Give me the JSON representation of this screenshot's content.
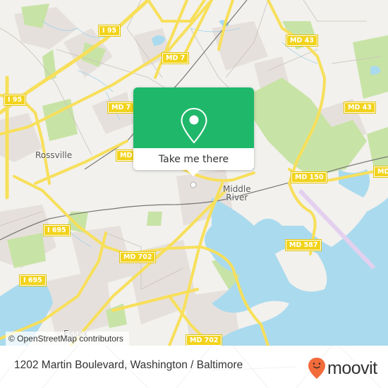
{
  "map": {
    "attribution": "© OpenStreetMap contributors",
    "road_shields": [
      {
        "id": "i95-top",
        "label": "I 95"
      },
      {
        "id": "i95-left",
        "label": "I 95"
      },
      {
        "id": "md7-top",
        "label": "MD 7"
      },
      {
        "id": "md7-mid",
        "label": "MD 7"
      },
      {
        "id": "md7-partial",
        "label": "MD"
      },
      {
        "id": "md43-top",
        "label": "MD 43"
      },
      {
        "id": "md43-right",
        "label": "MD 43"
      },
      {
        "id": "md150",
        "label": "MD 150"
      },
      {
        "id": "md-right-edge",
        "label": "MD"
      },
      {
        "id": "i695-top",
        "label": "I 695"
      },
      {
        "id": "i695-bottom",
        "label": "I 695"
      },
      {
        "id": "md702-mid",
        "label": "MD 702"
      },
      {
        "id": "md587",
        "label": "MD 587"
      },
      {
        "id": "md702-bottom",
        "label": "MD 702"
      }
    ],
    "places": [
      {
        "id": "rossville",
        "label": "Rossville"
      },
      {
        "id": "middle-river",
        "label": "Middle\nRiver"
      },
      {
        "id": "essex",
        "label": "Essex"
      }
    ],
    "colors": {
      "land": "#f2f1ed",
      "water": "#aadaee",
      "park": "#c8e3a6",
      "road": "#f7df5a",
      "residential": "#e6e0dc"
    }
  },
  "popup": {
    "action_label": "Take me there",
    "icon": "map-pin-icon",
    "color": "#1fb86a"
  },
  "footer": {
    "address": "1202 Martin Boulevard, Washington / Baltimore",
    "brand": "moovit",
    "brand_color": "#f26b3a"
  }
}
